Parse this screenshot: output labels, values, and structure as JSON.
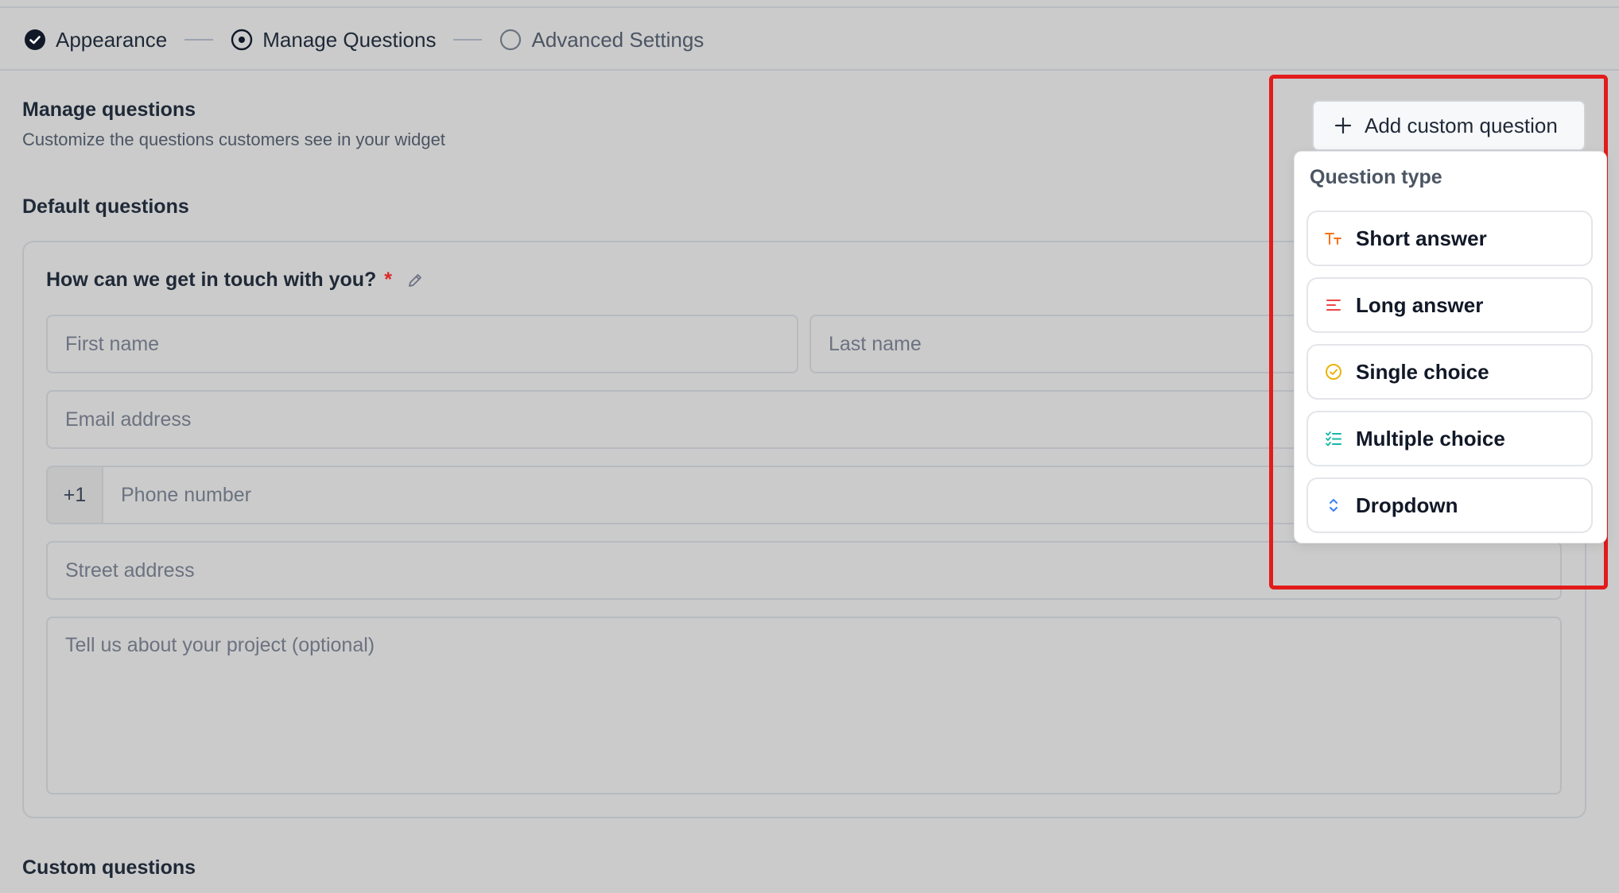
{
  "stepper": {
    "steps": [
      {
        "label": "Appearance",
        "state": "completed",
        "icon": "check-circle-icon"
      },
      {
        "label": "Manage Questions",
        "state": "current",
        "icon": "radio-dot-icon"
      },
      {
        "label": "Advanced Settings",
        "state": "upcoming",
        "icon": "empty-circle-icon"
      }
    ]
  },
  "header": {
    "title": "Manage questions",
    "subtitle": "Customize the questions customers see in your widget"
  },
  "default_section": {
    "title": "Default questions",
    "question": {
      "label": "How can we get in touch with you?",
      "required_marker": "*",
      "edit_icon": "pencil-icon"
    },
    "fields": {
      "first_name_placeholder": "First name",
      "last_name_placeholder": "Last name",
      "email_placeholder": "Email address",
      "phone_prefix": "+1",
      "phone_placeholder": "Phone number",
      "street_placeholder": "Street address",
      "project_placeholder": "Tell us about your project (optional)"
    }
  },
  "custom_section": {
    "title": "Custom questions"
  },
  "add_button": {
    "label": "Add custom question",
    "icon": "plus-icon"
  },
  "question_type_menu": {
    "title": "Question type",
    "options": [
      {
        "label": "Short answer",
        "icon": "text-size-icon",
        "color": "#f97316"
      },
      {
        "label": "Long answer",
        "icon": "text-lines-icon",
        "color": "#ef4444"
      },
      {
        "label": "Single choice",
        "icon": "check-circle-icon",
        "color": "#eab308"
      },
      {
        "label": "Multiple choice",
        "icon": "checklist-icon",
        "color": "#14b8a6"
      },
      {
        "label": "Dropdown",
        "icon": "chevron-up-down-icon",
        "color": "#3b82f6"
      }
    ]
  },
  "colors": {
    "highlight": "#e31b1b",
    "required": "#dc2626",
    "overlay_background": "#cbcbcb"
  }
}
